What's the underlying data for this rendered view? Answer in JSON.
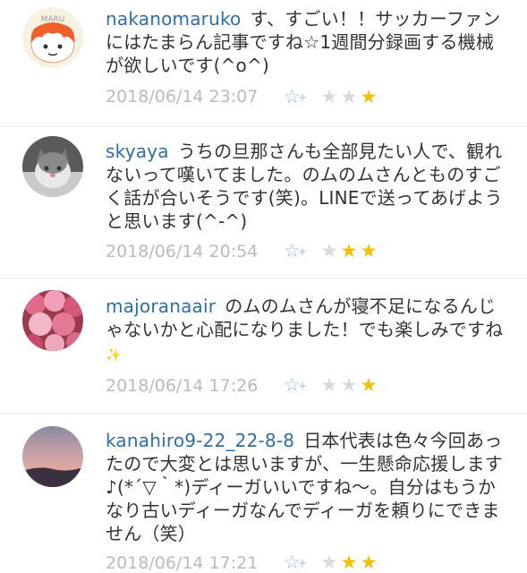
{
  "comments": [
    {
      "user": "nakanomaruko",
      "text": "す、すごい！！サッカーファンにはたまらん記事ですね☆1週間分録画する機械が欲しいです(^o^)",
      "date": "2018/06/14 23:07",
      "stars_gray": 2,
      "stars_gold": 1,
      "avatar": "maru-face-avatar",
      "avatar_label": "MARU"
    },
    {
      "user": "skyaya",
      "text": "うちの旦那さんも全部見たい人で、観れないって嘆いてました。のムのムさんとものすごく話が合いそうです(笑)。LINEで送ってあげようと思います(^-^)",
      "date": "2018/06/14 20:54",
      "stars_gray": 1,
      "stars_gold": 2,
      "avatar": "cat-avatar"
    },
    {
      "user": "majoranaair",
      "text": "のムのムさんが寝不足になるんじゃないかと心配になりました！でも楽しみですね",
      "date": "2018/06/14 17:26",
      "stars_gray": 2,
      "stars_gold": 1,
      "avatar": "roses-avatar"
    },
    {
      "user": "kanahiro9-22_22-8-8",
      "text": "日本代表は色々今回あったので大変とは思いますが、一生懸命応援します♪(*´▽｀*)ディーガいいですね〜。自分はもうかなり古いディーガなんでディーガを頼りにできません（笑）",
      "date": "2018/06/14 17:21",
      "stars_gray": 1,
      "stars_gold": 2,
      "avatar": "sunset-avatar"
    }
  ],
  "colors": {
    "username": "#2f6fa8",
    "date": "#bbbbbb",
    "star_gold": "#f5c000",
    "star_gray": "#d9d9d9",
    "star_add": "#9bbedf"
  },
  "icons": {
    "add_star": "add-star-icon",
    "star": "star-icon"
  }
}
